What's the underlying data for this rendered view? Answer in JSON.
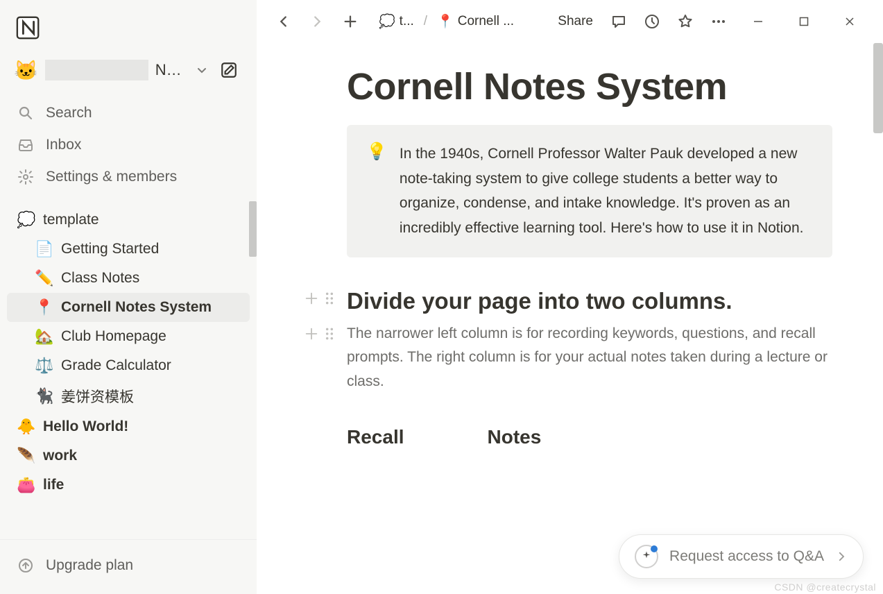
{
  "workspace": {
    "avatar_emoji": "🐱",
    "name_truncated": "No..."
  },
  "sidebar_nav": {
    "search": "Search",
    "inbox": "Inbox",
    "settings": "Settings & members"
  },
  "sidebar_pages": {
    "template": {
      "emoji": "💭",
      "label": "template"
    },
    "children": [
      {
        "emoji": "📄",
        "label": "Getting Started"
      },
      {
        "emoji": "✏️",
        "label": "Class Notes"
      },
      {
        "emoji": "📍",
        "label": "Cornell Notes System",
        "selected": true
      },
      {
        "emoji": "🏡",
        "label": "Club Homepage"
      },
      {
        "emoji": "⚖️",
        "label": "Grade Calculator"
      },
      {
        "emoji": "🐈‍⬛",
        "label": "姜饼资模板"
      }
    ],
    "top_level": [
      {
        "emoji": "🐥",
        "label": "Hello World!"
      },
      {
        "emoji": "🪶",
        "label": "work"
      },
      {
        "emoji": "👛",
        "label": "life"
      }
    ]
  },
  "sidebar_footer": {
    "upgrade": "Upgrade plan"
  },
  "breadcrumb": {
    "seg1": {
      "emoji": "💭",
      "label": "t..."
    },
    "seg2": {
      "emoji": "📍",
      "label": "Cornell ..."
    }
  },
  "topbar": {
    "share": "Share"
  },
  "page": {
    "title": "Cornell Notes System",
    "callout_emoji": "💡",
    "callout_text": "In the 1940s, Cornell Professor Walter Pauk developed a new note-taking system to give college students a better way to organize, condense, and intake knowledge. It's proven as an incredibly effective learning tool. Here's how to use it in Notion.",
    "h2": "Divide your page into two columns.",
    "para": "The narrower left column is for recording keywords, questions, and recall prompts. The right column is for your actual notes taken during a lecture or class.",
    "col1": "Recall",
    "col2": "Notes"
  },
  "qa": {
    "label": "Request access to Q&A"
  },
  "watermark": "CSDN @createcrystal"
}
